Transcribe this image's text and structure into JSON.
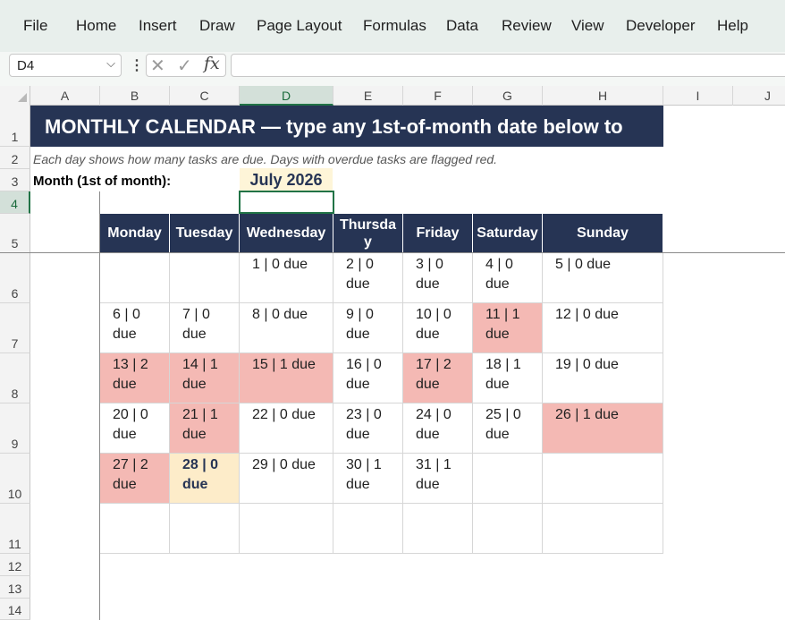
{
  "menu": [
    "File",
    "Home",
    "Insert",
    "Draw",
    "Page Layout",
    "Formulas",
    "Data",
    "Review",
    "View",
    "Developer",
    "Help"
  ],
  "formula_bar": {
    "name_box": "D4",
    "formula": ""
  },
  "columns": [
    "A",
    "B",
    "C",
    "D",
    "E",
    "F",
    "G",
    "H",
    "I",
    "J"
  ],
  "selected_column": "D",
  "rows": [
    "1",
    "2",
    "3",
    "4",
    "5",
    "6",
    "7",
    "8",
    "9",
    "10",
    "11",
    "12",
    "13",
    "14"
  ],
  "selected_row": "4",
  "sheet": {
    "title": "MONTHLY CALENDAR  —  type any 1st-of-month date below to",
    "subtitle": "Each day shows how many tasks are due. Days with overdue tasks are flagged red.",
    "month_label": "Month (1st of month):",
    "month_value": "July 2026"
  },
  "calendar": {
    "day_headers": [
      "Monday",
      "Tuesday",
      "Wednesday",
      "Thursday",
      "Friday",
      "Saturday",
      "Sunday"
    ],
    "weeks": [
      [
        {
          "text": ""
        },
        {
          "text": ""
        },
        {
          "text": "1  |  0 due"
        },
        {
          "text": "2  |  0 due"
        },
        {
          "text": "3  |  0 due"
        },
        {
          "text": "4  |  0 due"
        },
        {
          "text": "5  |  0 due"
        }
      ],
      [
        {
          "text": "6  |  0 due"
        },
        {
          "text": "7  |  0 due"
        },
        {
          "text": "8  |  0 due"
        },
        {
          "text": "9  |  0 due"
        },
        {
          "text": "10  |  0 due"
        },
        {
          "text": "11  |  1 due",
          "state": "flag"
        },
        {
          "text": "12  |  0 due"
        }
      ],
      [
        {
          "text": "13  |  2 due",
          "state": "flag"
        },
        {
          "text": "14  |  1 due",
          "state": "flag"
        },
        {
          "text": "15  |  1 due",
          "state": "flag"
        },
        {
          "text": "16  |  0 due"
        },
        {
          "text": "17  |  2 due",
          "state": "flag"
        },
        {
          "text": "18  |  1 due"
        },
        {
          "text": "19  |  0 due"
        }
      ],
      [
        {
          "text": "20  |  0 due"
        },
        {
          "text": "21  |  1 due",
          "state": "flag"
        },
        {
          "text": "22  |  0 due"
        },
        {
          "text": "23  |  0 due"
        },
        {
          "text": "24  |  0 due"
        },
        {
          "text": "25  |  0 due"
        },
        {
          "text": "26  |  1 due",
          "state": "flag"
        }
      ],
      [
        {
          "text": "27  |  2 due",
          "state": "flag"
        },
        {
          "text": "28  |  0 due",
          "state": "today"
        },
        {
          "text": "29  |  0 due"
        },
        {
          "text": "30  |  1 due"
        },
        {
          "text": "31  |  1 due"
        },
        {
          "text": ""
        },
        {
          "text": ""
        }
      ],
      [
        {
          "text": ""
        },
        {
          "text": ""
        },
        {
          "text": ""
        },
        {
          "text": ""
        },
        {
          "text": ""
        },
        {
          "text": ""
        },
        {
          "text": ""
        }
      ]
    ]
  }
}
